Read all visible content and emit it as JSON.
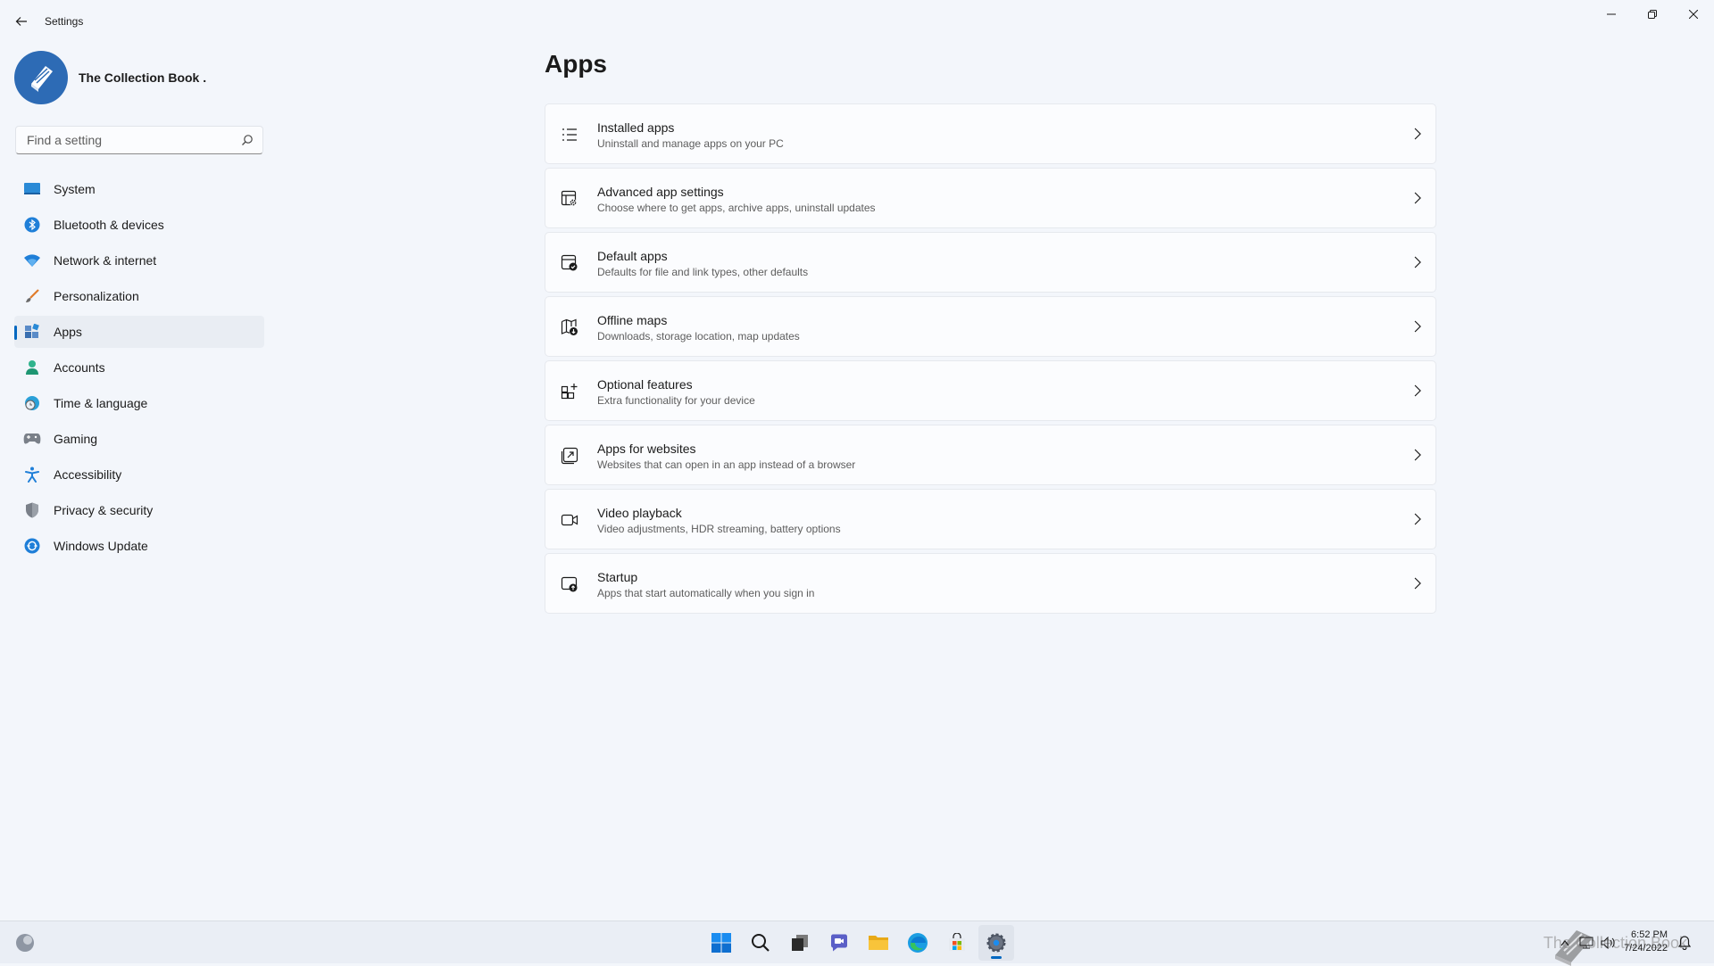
{
  "window": {
    "title": "Settings"
  },
  "profile": {
    "name": "The Collection Book ."
  },
  "search": {
    "placeholder": "Find a setting"
  },
  "sidebar": {
    "items": [
      {
        "label": "System",
        "icon": "monitor-icon"
      },
      {
        "label": "Bluetooth & devices",
        "icon": "bluetooth-icon"
      },
      {
        "label": "Network & internet",
        "icon": "wifi-icon"
      },
      {
        "label": "Personalization",
        "icon": "brush-icon"
      },
      {
        "label": "Apps",
        "icon": "apps-icon",
        "active": true
      },
      {
        "label": "Accounts",
        "icon": "person-icon"
      },
      {
        "label": "Time & language",
        "icon": "globe-clock-icon"
      },
      {
        "label": "Gaming",
        "icon": "gamepad-icon"
      },
      {
        "label": "Accessibility",
        "icon": "accessibility-icon"
      },
      {
        "label": "Privacy & security",
        "icon": "shield-icon"
      },
      {
        "label": "Windows Update",
        "icon": "update-icon"
      }
    ]
  },
  "main": {
    "title": "Apps",
    "cards": [
      {
        "title": "Installed apps",
        "subtitle": "Uninstall and manage apps on your PC",
        "icon": "list-icon"
      },
      {
        "title": "Advanced app settings",
        "subtitle": "Choose where to get apps, archive apps, uninstall updates",
        "icon": "app-settings-icon"
      },
      {
        "title": "Default apps",
        "subtitle": "Defaults for file and link types, other defaults",
        "icon": "default-apps-icon"
      },
      {
        "title": "Offline maps",
        "subtitle": "Downloads, storage location, map updates",
        "icon": "map-download-icon"
      },
      {
        "title": "Optional features",
        "subtitle": "Extra functionality for your device",
        "icon": "add-grid-icon"
      },
      {
        "title": "Apps for websites",
        "subtitle": "Websites that can open in an app instead of a browser",
        "icon": "open-external-icon"
      },
      {
        "title": "Video playback",
        "subtitle": "Video adjustments, HDR streaming, battery options",
        "icon": "video-icon"
      },
      {
        "title": "Startup",
        "subtitle": "Apps that start automatically when you sign in",
        "icon": "startup-icon"
      }
    ]
  },
  "taskbar": {
    "watermark_text": "The Collection Book",
    "time": "6:52 PM",
    "date": "7/24/2022"
  },
  "colors": {
    "accent": "#0067c0",
    "background": "#f3f6fb",
    "card": "#fbfcfe"
  }
}
